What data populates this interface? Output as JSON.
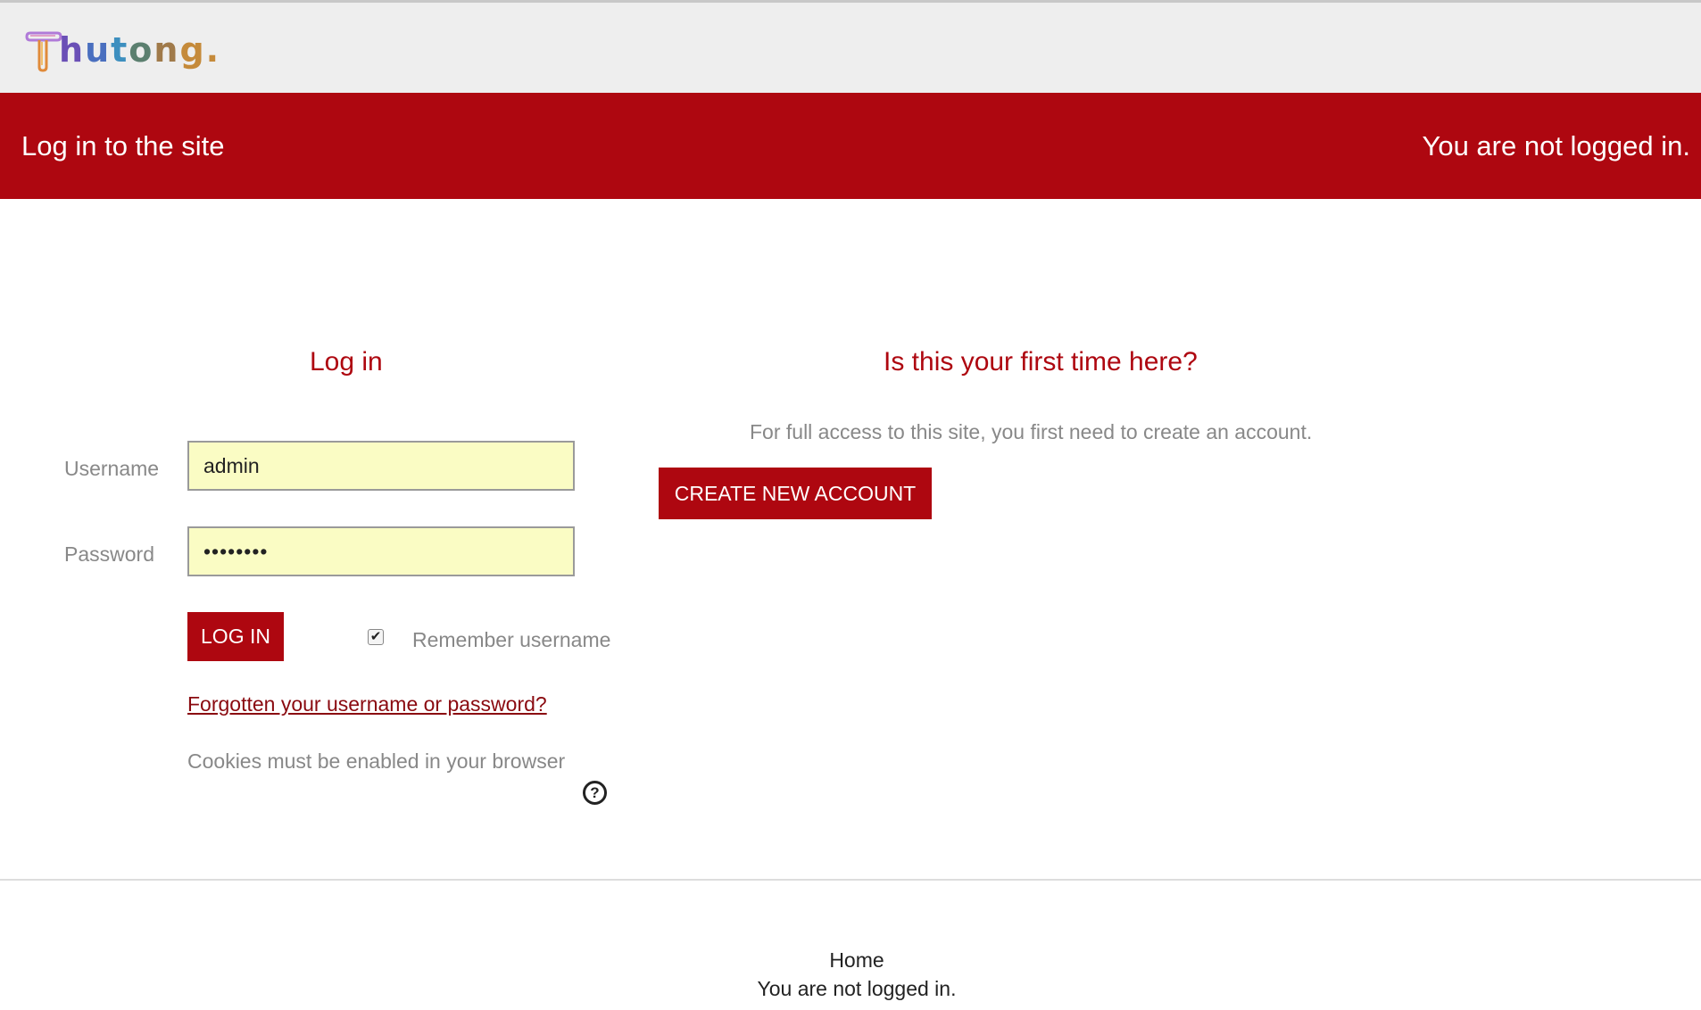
{
  "logo": {
    "letters": [
      "h",
      "u",
      "t",
      "o",
      "n",
      "g."
    ]
  },
  "banner": {
    "title": "Log in to the site",
    "status": "You are not logged in."
  },
  "login": {
    "heading": "Log in",
    "username_label": "Username",
    "username_value": "admin",
    "password_label": "Password",
    "password_value": "••••••••",
    "login_button": "LOG IN",
    "remember_checked": true,
    "remember_label": "Remember username",
    "forgot_link": "Forgotten your username or password?",
    "cookies_note": "Cookies must be enabled in your browser"
  },
  "signup": {
    "heading": "Is this your first time here?",
    "description": "For full access to this site, you first need to create an account.",
    "create_button": "CREATE NEW ACCOUNT"
  },
  "footer": {
    "home_link": "Home",
    "status": "You are not logged in."
  },
  "colors": {
    "brand_red": "#ae0710",
    "input_bg": "#fafcc4",
    "header_bg": "#eeeeee"
  }
}
